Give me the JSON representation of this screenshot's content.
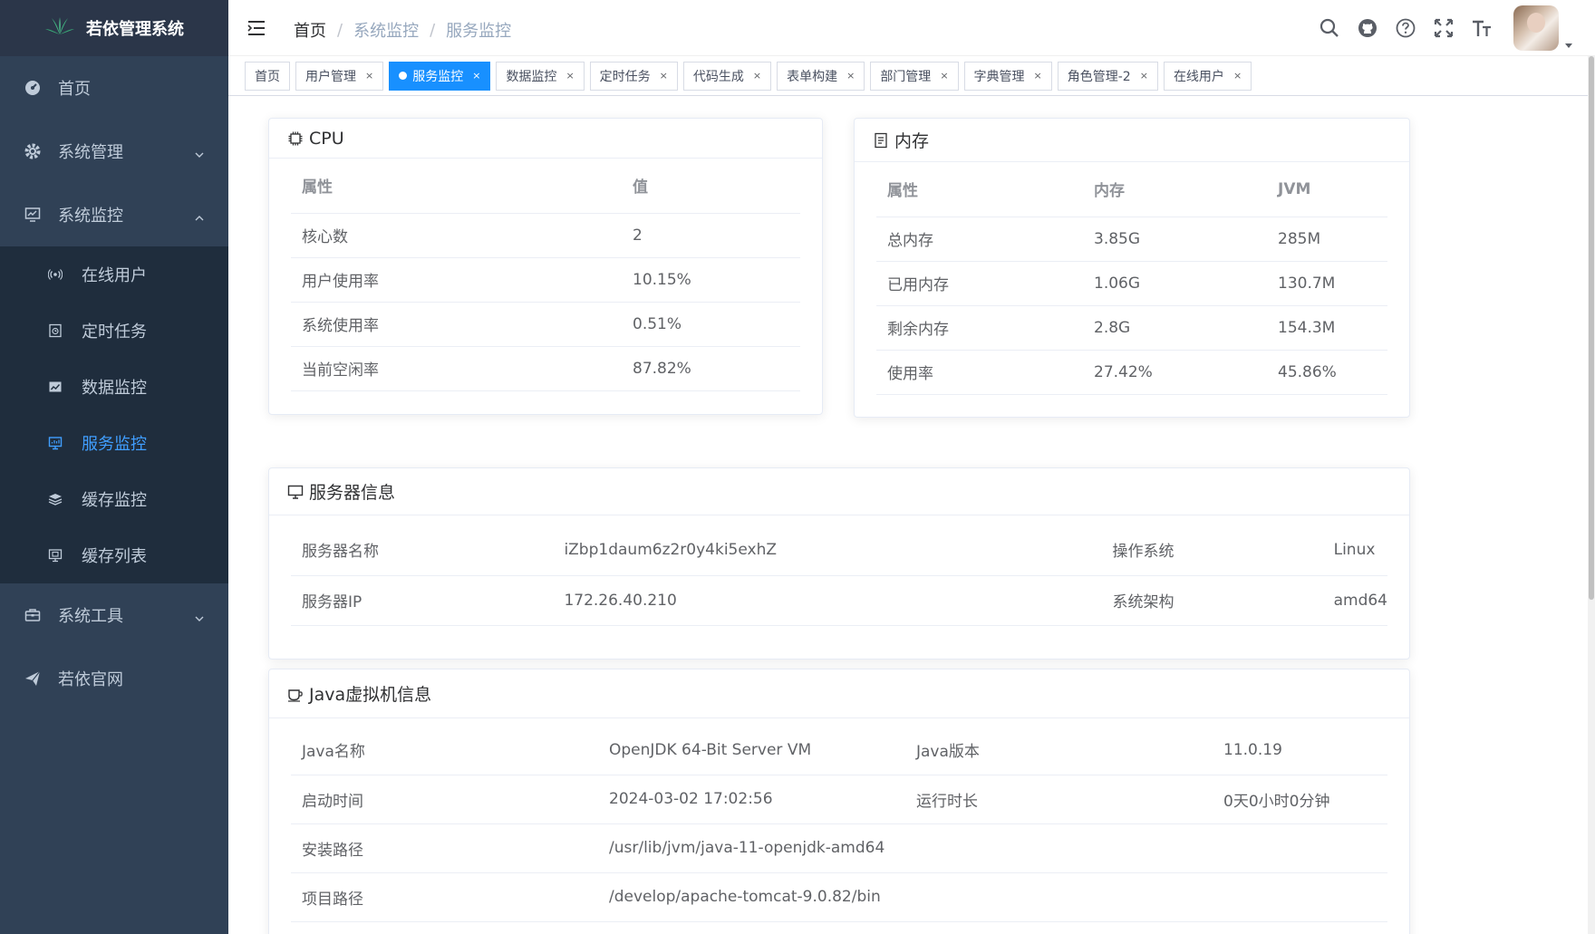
{
  "app": {
    "title": "若依管理系统"
  },
  "sidebar": {
    "items": [
      {
        "label": "首页",
        "icon": "dashboard-icon"
      },
      {
        "label": "系统管理",
        "icon": "gear-icon",
        "expanded": false
      },
      {
        "label": "系统监控",
        "icon": "monitor-icon",
        "expanded": true
      },
      {
        "label": "系统工具",
        "icon": "toolbox-icon",
        "expanded": false
      },
      {
        "label": "若依官网",
        "icon": "send-icon"
      }
    ],
    "monitor_sub": [
      {
        "label": "在线用户",
        "icon": "online-icon"
      },
      {
        "label": "定时任务",
        "icon": "job-icon"
      },
      {
        "label": "数据监控",
        "icon": "druid-icon"
      },
      {
        "label": "服务监控",
        "icon": "server-icon",
        "active": true
      },
      {
        "label": "缓存监控",
        "icon": "redis-icon"
      },
      {
        "label": "缓存列表",
        "icon": "redis-list-icon"
      }
    ]
  },
  "breadcrumb": [
    "首页",
    "系统监控",
    "服务监控"
  ],
  "tags": [
    {
      "label": "首页",
      "closable": false
    },
    {
      "label": "用户管理",
      "closable": true
    },
    {
      "label": "服务监控",
      "closable": true,
      "active": true
    },
    {
      "label": "数据监控",
      "closable": true
    },
    {
      "label": "定时任务",
      "closable": true
    },
    {
      "label": "代码生成",
      "closable": true
    },
    {
      "label": "表单构建",
      "closable": true
    },
    {
      "label": "部门管理",
      "closable": true
    },
    {
      "label": "字典管理",
      "closable": true
    },
    {
      "label": "角色管理-2",
      "closable": true
    },
    {
      "label": "在线用户",
      "closable": true
    }
  ],
  "tag_close_glyph": "×",
  "cpu": {
    "title": "CPU",
    "headers": [
      "属性",
      "值"
    ],
    "rows": [
      [
        "核心数",
        "2"
      ],
      [
        "用户使用率",
        "10.15%"
      ],
      [
        "系统使用率",
        "0.51%"
      ],
      [
        "当前空闲率",
        "87.82%"
      ]
    ]
  },
  "mem": {
    "title": "内存",
    "headers": [
      "属性",
      "内存",
      "JVM"
    ],
    "rows": [
      [
        "总内存",
        "3.85G",
        "285M"
      ],
      [
        "已用内存",
        "1.06G",
        "130.7M"
      ],
      [
        "剩余内存",
        "2.8G",
        "154.3M"
      ],
      [
        "使用率",
        "27.42%",
        "45.86%"
      ]
    ]
  },
  "server": {
    "title": "服务器信息",
    "rows": [
      [
        "服务器名称",
        "iZbp1daum6z2r0y4ki5exhZ",
        "操作系统",
        "Linux"
      ],
      [
        "服务器IP",
        "172.26.40.210",
        "系统架构",
        "amd64"
      ]
    ]
  },
  "jvm": {
    "title": "Java虚拟机信息",
    "rows": [
      [
        "Java名称",
        "OpenJDK 64-Bit Server VM",
        "Java版本",
        "11.0.19"
      ],
      [
        "启动时间",
        "2024-03-02 17:02:56",
        "运行时长",
        "0天0小时0分钟"
      ],
      [
        "安装路径",
        "/usr/lib/jvm/java-11-openjdk-amd64",
        "",
        ""
      ],
      [
        "项目路径",
        "/develop/apache-tomcat-9.0.82/bin",
        "",
        ""
      ]
    ]
  },
  "colors": {
    "sidebar_bg": "#304156",
    "submenu_bg": "#1f2d3d",
    "active": "#1890ff",
    "active_menu_text": "#409eff"
  }
}
